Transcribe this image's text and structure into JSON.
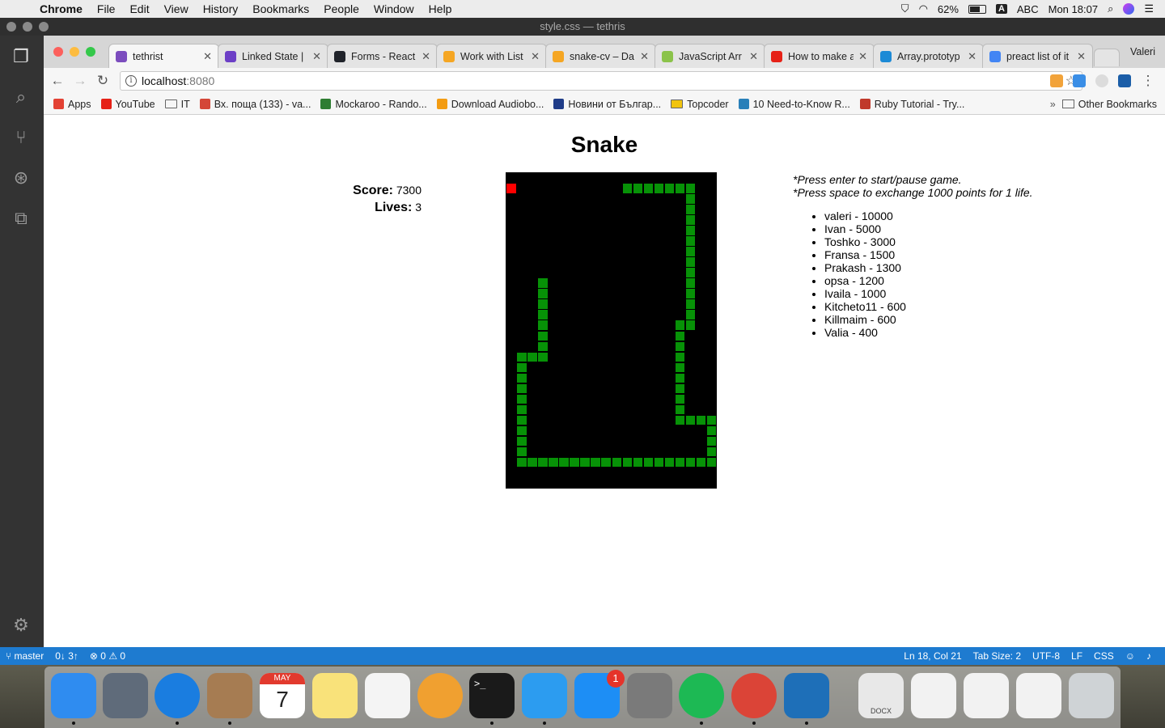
{
  "menubar": {
    "app": "Chrome",
    "items": [
      "File",
      "Edit",
      "View",
      "History",
      "Bookmarks",
      "People",
      "Window",
      "Help"
    ],
    "battery": "62%",
    "input_badge": "A",
    "input_source": "ABC",
    "clock": "Mon 18:07"
  },
  "vscode": {
    "title": "style.css — tethris",
    "status_left": [
      "master",
      "0↓ 3↑",
      "⊗ 0 ⚠ 0"
    ],
    "status_right": [
      "Ln 18, Col 21",
      "Tab Size: 2",
      "UTF-8",
      "LF",
      "CSS"
    ]
  },
  "chrome": {
    "profile": "Valeri",
    "tabs": [
      {
        "label": "tethrist",
        "color": "#7c4dbe",
        "active": true
      },
      {
        "label": "Linked State |",
        "color": "#6c3fc6",
        "active": false
      },
      {
        "label": "Forms - React",
        "color": "#20232a",
        "active": false
      },
      {
        "label": "Work with List",
        "color": "#f5a623",
        "active": false
      },
      {
        "label": "snake-cv – Da",
        "color": "#f5a623",
        "active": false
      },
      {
        "label": "JavaScript Arr",
        "color": "#8bc34a",
        "active": false
      },
      {
        "label": "How to make a",
        "color": "#e62117",
        "active": false
      },
      {
        "label": "Array.prototyp",
        "color": "#1c8ad6",
        "active": false
      },
      {
        "label": "preact list of it",
        "color": "#4285f4",
        "active": false
      }
    ],
    "url_host": "localhost",
    "url_port": ":8080",
    "bookmarks": [
      {
        "label": "Apps",
        "icon": "apps-grid-icon",
        "color": "#e34133"
      },
      {
        "label": "YouTube",
        "icon": "youtube-icon",
        "color": "#e62117"
      },
      {
        "label": "IT",
        "icon": "folder-icon",
        "color": ""
      },
      {
        "label": "Вх. поща (133) - va...",
        "icon": "gmail-icon",
        "color": "#d44638"
      },
      {
        "label": "Mockaroo - Rando...",
        "icon": "mockaroo-icon",
        "color": "#2e7d32"
      },
      {
        "label": "Download Audiobo...",
        "icon": "audiobook-icon",
        "color": "#f39c12"
      },
      {
        "label": "Новини от Българ...",
        "icon": "news-icon",
        "color": "#1f3c88"
      },
      {
        "label": "Topcoder",
        "icon": "folder-icon",
        "color": "#f1c40f"
      },
      {
        "label": "10 Need-to-Know R...",
        "icon": "blog-icon",
        "color": "#2980b9"
      },
      {
        "label": "Ruby Tutorial - Try...",
        "icon": "ruby-icon",
        "color": "#c0392b"
      }
    ],
    "bookmarks_more": "»",
    "other_bookmarks": "Other Bookmarks"
  },
  "game": {
    "title": "Snake",
    "score_label": "Score:",
    "score": "7300",
    "lives_label": "Lives:",
    "lives": "3",
    "instructions": [
      "*Press enter to start/pause game.",
      "*Press space to exchange 1000 points for 1 life."
    ],
    "leaderboard": [
      "valeri - 10000",
      "Ivan - 5000",
      "Toshko - 3000",
      "Fransa - 1500",
      "Prakash - 1300",
      "opsa - 1200",
      "Ivaila - 1000",
      "Kitcheto11 - 600",
      "Killmaim - 600",
      "Valia - 400"
    ],
    "board_cols": 20,
    "board_rows": 30,
    "food": [
      0,
      1
    ],
    "snake_path": [
      [
        3,
        10
      ],
      [
        3,
        17
      ],
      [
        1,
        17
      ],
      [
        1,
        27
      ],
      [
        19,
        27
      ],
      [
        19,
        23
      ],
      [
        16,
        23
      ],
      [
        16,
        14
      ],
      [
        17,
        14
      ],
      [
        17,
        1
      ],
      [
        11,
        1
      ]
    ]
  },
  "dock": {
    "apps": [
      {
        "name": "finder-icon",
        "color": "#2f8cf0",
        "running": true
      },
      {
        "name": "launchpad-icon",
        "color": "#5f6b7a",
        "running": false
      },
      {
        "name": "safari-icon",
        "color": "#1a7de0",
        "running": true
      },
      {
        "name": "mail-icon",
        "color": "#a67c52",
        "running": true
      },
      {
        "name": "calendar-icon",
        "color": "#ffffff",
        "running": false
      },
      {
        "name": "notes-icon",
        "color": "#f9e27a",
        "running": false
      },
      {
        "name": "reminders-icon",
        "color": "#f4f4f4",
        "running": false
      },
      {
        "name": "photos-icon",
        "color": "#f0a030",
        "running": false
      },
      {
        "name": "terminal-icon",
        "color": "#1a1a1a",
        "running": true
      },
      {
        "name": "messages-icon",
        "color": "#2c9cf0",
        "running": true
      },
      {
        "name": "app-store-icon",
        "color": "#1d8ef5",
        "running": false
      },
      {
        "name": "system-preferences-icon",
        "color": "#7a7a7a",
        "running": false
      },
      {
        "name": "spotify-icon",
        "color": "#1db954",
        "running": true
      },
      {
        "name": "chrome-icon",
        "color": "#db4437",
        "running": true
      },
      {
        "name": "vscode-icon",
        "color": "#1e6fb8",
        "running": true
      },
      {
        "name": "document-icon",
        "color": "#e8e8e8",
        "running": false
      },
      {
        "name": "screenshot-1-icon",
        "color": "#f2f2f2",
        "running": false
      },
      {
        "name": "screenshot-2-icon",
        "color": "#f2f2f2",
        "running": false
      },
      {
        "name": "screenshot-3-icon",
        "color": "#f2f2f2",
        "running": false
      },
      {
        "name": "trash-icon",
        "color": "#cfd3d6",
        "running": false
      }
    ],
    "app_store_badge": "1",
    "calendar_month": "MAY",
    "calendar_day": "7",
    "document_label": "DOCX"
  }
}
